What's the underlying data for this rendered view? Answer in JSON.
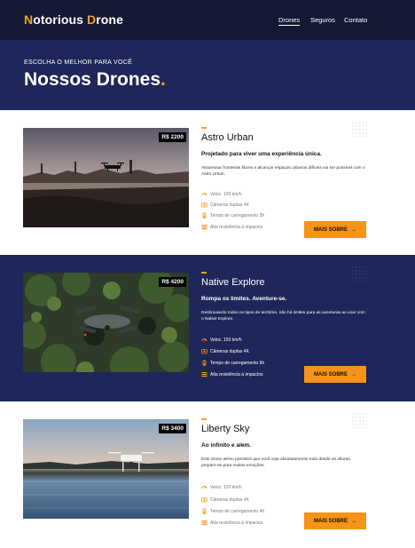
{
  "header": {
    "logo_prefix_initial": "N",
    "logo_word1_rest": "otorious ",
    "logo_second_initial": "D",
    "logo_word2_rest": "rone",
    "nav": [
      {
        "label": "Drones",
        "active": true
      },
      {
        "label": "Seguros",
        "active": false
      },
      {
        "label": "Contato",
        "active": false
      }
    ]
  },
  "hero": {
    "subtitle": "ESCOLHA O MELHOR PARA VOCÊ",
    "title": "Nossos Drones",
    "title_dot": "."
  },
  "colors": {
    "accent": "#f7a21b",
    "navy": "#1f2659",
    "topbar": "#131833",
    "button": "#f7931a"
  },
  "drones": [
    {
      "price": "R$ 2200",
      "name": "Astro Urban",
      "tagline": "Projetado para viver uma experiência única.",
      "description": "Atravessar fronteiras fáceis e alcançar espaços urbanos difíceis vai ser possível com o Astro Urban.",
      "specs": [
        {
          "icon": "speed-icon",
          "text": "Veloc. 100 km/h"
        },
        {
          "icon": "camera-icon",
          "text": "Câmeras duplas 4K"
        },
        {
          "icon": "battery-icon",
          "text": "Tempo de carregamento 3h"
        },
        {
          "icon": "resistance-icon",
          "text": "Alta resistência à impactos"
        }
      ],
      "button": "MAIS SOBRE",
      "button_arrow": "→"
    },
    {
      "price": "R$ 4200",
      "name": "Native Explore",
      "tagline": "Rompa os limites. Aventure-se.",
      "description": "Desbravando todos os tipos de território, não há limites para as aventuras ao voar com o Native Explore.",
      "specs": [
        {
          "icon": "speed-icon",
          "text": "Veloc. 150 km/h"
        },
        {
          "icon": "camera-icon",
          "text": "Câmeras duplas 4K"
        },
        {
          "icon": "battery-icon",
          "text": "Tempo de carregamento 6h"
        },
        {
          "icon": "resistance-icon",
          "text": "Alta resistência à impactos"
        }
      ],
      "button": "MAIS SOBRE",
      "button_arrow": "→"
    },
    {
      "price": "R$ 3400",
      "name": "Liberty Sky",
      "tagline": "Ao infinito e além.",
      "description": "Este drone aéreo permitirá que você veja absolutamente tudo desde as alturas, prepare-se para muitas emoções.",
      "specs": [
        {
          "icon": "speed-icon",
          "text": "Veloc. 120 km/h"
        },
        {
          "icon": "camera-icon",
          "text": "Câmeras duplas 4K"
        },
        {
          "icon": "battery-icon",
          "text": "Tempo de carregamento 4h"
        },
        {
          "icon": "resistance-icon",
          "text": "Alta resistência à impactos"
        }
      ],
      "button": "MAIS SOBRE",
      "button_arrow": "→"
    }
  ]
}
